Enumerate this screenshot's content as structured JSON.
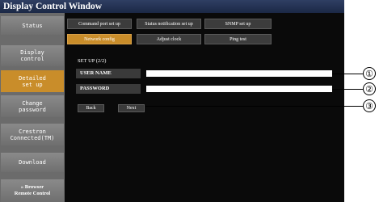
{
  "window": {
    "title": "Display Control Window"
  },
  "sidebar": {
    "items": [
      {
        "label": "Status"
      },
      {
        "label": "Display\ncontrol"
      },
      {
        "label": "Detailed\nset up"
      },
      {
        "label": "Change\npassword"
      },
      {
        "label": "Crestron\nConnected(TM)"
      },
      {
        "label": "Download"
      },
      {
        "label": "» Browser\nRemote Control"
      }
    ]
  },
  "tabs": [
    {
      "label": "Command port set up"
    },
    {
      "label": "Status notification set up"
    },
    {
      "label": "SNMP set up"
    },
    {
      "label": "Network config"
    },
    {
      "label": "Adjust clock"
    },
    {
      "label": "Ping test"
    }
  ],
  "form": {
    "heading": "SET UP (2/2)",
    "username_label": "USER NAME",
    "password_label": "PASSWORD",
    "username_value": "",
    "password_value": "",
    "back_label": "Back",
    "next_label": "Next"
  },
  "callouts": [
    "①",
    "②",
    "③"
  ],
  "colors": {
    "active": "#c98d2a",
    "titlebar": "#1b2846",
    "main_bg": "#0a0a0a"
  }
}
